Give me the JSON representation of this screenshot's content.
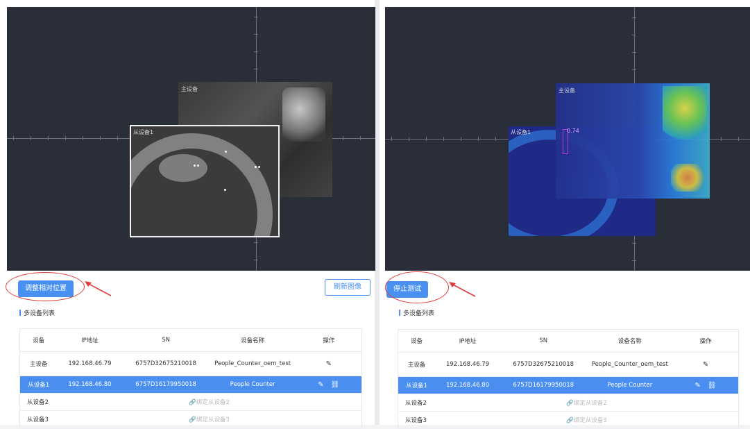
{
  "left": {
    "canvas": {
      "master_label": "主设备",
      "slave_label": "从设备1"
    },
    "primary_button": "调整相对位置",
    "refresh_button": "刷新图像"
  },
  "right": {
    "canvas": {
      "master_label": "主设备",
      "slave_label": "从设备1",
      "overlay_text": "0.74"
    },
    "primary_button": "停止测试"
  },
  "section_title": "多设备列表",
  "table": {
    "headers": [
      "设备",
      "IP地址",
      "SN",
      "设备名称",
      "操作"
    ],
    "rows": [
      {
        "device": "主设备",
        "ip": "192.168.46.79",
        "sn": "6757D32675210018",
        "name": "People_Counter_oem_test",
        "ops": [
          "edit-icon"
        ]
      },
      {
        "device": "从设备1",
        "ip": "192.168.46.80",
        "sn": "6757D16179950018",
        "name": "People Counter",
        "ops": [
          "edit-icon",
          "link-icon"
        ],
        "selected": true
      },
      {
        "device": "从设备2",
        "bind": "绑定从设备2"
      },
      {
        "device": "从设备3",
        "bind": "绑定从设备3"
      }
    ]
  },
  "colors": {
    "accent": "#4a90f0",
    "selected_row": "#4a8ff0",
    "annotation": "#e03a3a",
    "canvas_bg": "#2a2e38"
  }
}
